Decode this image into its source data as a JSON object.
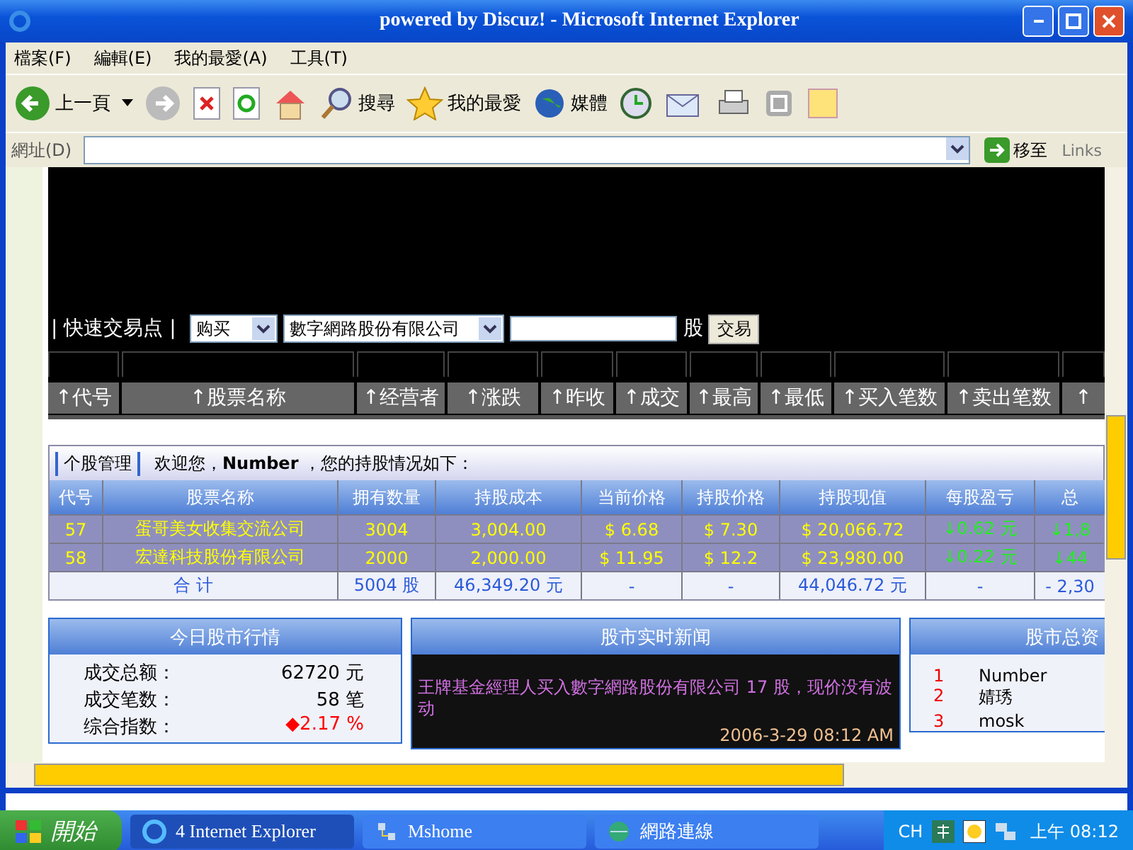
{
  "window": {
    "title": "powered by Discuz! - Microsoft Internet Explorer"
  },
  "menu": [
    "檔案(F)",
    "編輯(E)",
    "我的最愛(A)",
    "工具(T)"
  ],
  "toolbar": {
    "back": "上一頁",
    "search": "搜尋",
    "favorites": "我的最愛",
    "media": "媒體"
  },
  "address_bar": {
    "label": "網址(D)",
    "go": "移至",
    "links": "Links"
  },
  "quick_trade": {
    "label": "| 快速交易点 |",
    "action": "购买",
    "stock": "數字網路股份有限公司",
    "unit": "股",
    "button": "交易"
  },
  "market_columns": [
    "↑代号",
    "↑股票名称",
    "↑经营者",
    "↑涨跌",
    "↑昨收",
    "↑成交",
    "↑最高",
    "↑最低",
    "↑买入笔数",
    "↑卖出笔数",
    "↑"
  ],
  "holdings": {
    "title": "个股管理",
    "welcome": "欢迎您，**Number** ，您的持股情况如下：",
    "columns": [
      "代号",
      "股票名称",
      "拥有数量",
      "持股成本",
      "当前价格",
      "持股价格",
      "持股现值",
      "每股盈亏",
      "总"
    ],
    "rows": [
      [
        "57",
        "蛋哥美女收集交流公司",
        "3004",
        "3,004.00",
        "$ 6.68",
        "$ 7.30",
        "$ 20,066.72",
        {
          "text": "↓0.62 元",
          "kind": "loss"
        },
        {
          "text": "↓1,8",
          "kind": "loss"
        }
      ],
      [
        "58",
        "宏達科技股份有限公司",
        "2000",
        "2,000.00",
        "$ 11.95",
        "$ 12.2",
        "$ 23,980.00",
        {
          "text": "↓0.22 元",
          "kind": "loss"
        },
        {
          "text": "↓44",
          "kind": "loss"
        }
      ]
    ],
    "total": [
      "合 计",
      "5004 股",
      "46,349.20 元",
      "-",
      "-",
      "44,046.72 元",
      "-",
      "- 2,30"
    ]
  },
  "market_today": {
    "title": "今日股市行情",
    "items": [
      {
        "label": "成交总额：",
        "value": "62720 元",
        "color": "#000000"
      },
      {
        "label": "成交笔数：",
        "value": "58 笔",
        "color": "#000000"
      },
      {
        "label": "综合指数：",
        "value": "◆2.17 %",
        "color": "#ff0000"
      }
    ]
  },
  "news": {
    "title": "股市实时新闻",
    "text": "王牌基金經理人买入數字網路股份有限公司 17 股，现价没有波动",
    "time": "2006-3-29 08:12 AM"
  },
  "ranking": {
    "title": "股市总资",
    "items": [
      {
        "rank": "1",
        "name": "Number"
      },
      {
        "rank": "2",
        "name": "婧琇"
      },
      {
        "rank": "3",
        "name": "mosk"
      }
    ]
  },
  "taskbar": {
    "start": "開始",
    "tasks": [
      {
        "label": "4 Internet Explorer",
        "selected": true
      },
      {
        "label": "Mshome",
        "selected": false
      },
      {
        "label": "網路連線",
        "selected": false
      }
    ],
    "language": "CH",
    "clock": "上午 08:12"
  }
}
